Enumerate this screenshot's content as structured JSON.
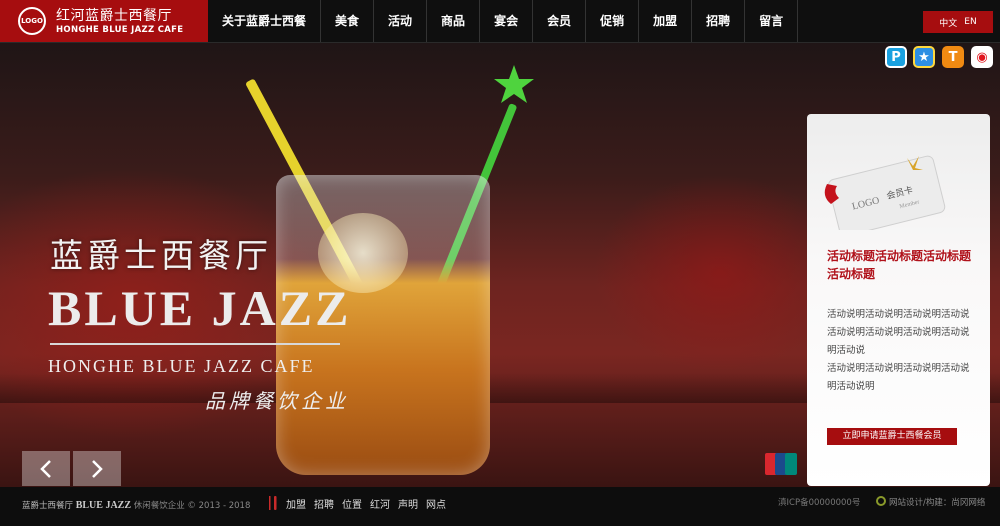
{
  "header": {
    "logo_mark": "LOGO",
    "logo_cn": "红河蓝爵士西餐厅",
    "logo_en": "HONGHE BLUE JAZZ CAFE",
    "nav": [
      "关于蓝爵士西餐",
      "美食",
      "活动",
      "商品",
      "宴会",
      "会员",
      "促销",
      "加盟",
      "招聘",
      "留言"
    ],
    "lang_cn": "中文",
    "lang_en": "EN"
  },
  "hero": {
    "title_cn": "蓝爵士西餐厅",
    "title_en": "BLUE JAZZ",
    "subtitle_en": "HONGHE BLUE JAZZ CAFE",
    "brand_cn": "品牌餐饮企业"
  },
  "panel": {
    "card_logo": "LOGO",
    "card_label": "会员卡",
    "card_member": "Member",
    "title": "活动标题活动标题活动标题活动标题",
    "desc": [
      "活动说明活动说明活动说明活动说",
      "活动说明活动说明活动说明活动说明活动说",
      "活动说明活动说明活动说明活动说明活动说明"
    ],
    "button": "立即申请蓝爵士西餐会员"
  },
  "icons": {
    "social": [
      "p-icon",
      "qzone-icon",
      "tencent-weibo-icon",
      "sina-weibo-icon"
    ],
    "arrows": [
      "chevron-left-icon",
      "chevron-right-icon"
    ]
  },
  "footer": {
    "brand_cn": "蓝爵士西餐厅",
    "brand_en": "BLUE JAZZ",
    "brand_rest": "休闲餐饮企业 © 2013 - 2018",
    "links": [
      "加盟",
      "招聘",
      "位置",
      "红河",
      "声明",
      "网点"
    ],
    "icp": "滇ICP备00000000号",
    "design": "网站设计/构建：尚冈网络"
  },
  "colors": {
    "brand_red": "#a60d0f",
    "dark": "#0f0f0f"
  }
}
